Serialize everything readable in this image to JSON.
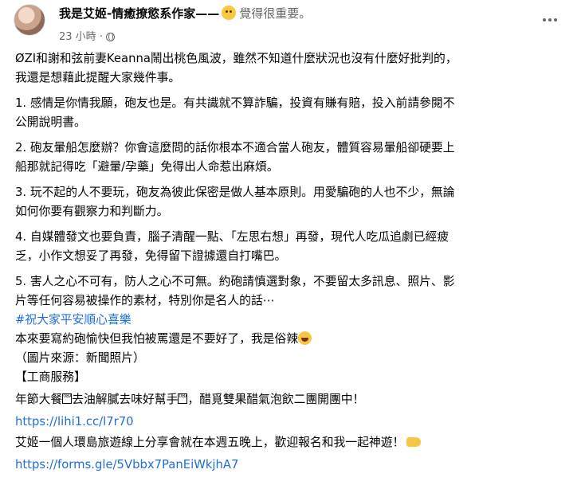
{
  "header": {
    "author": "我是艾姬-情癒撩慾系作家",
    "dash": "——",
    "feeling_icon": "thinking-face-emoji",
    "feeling": "覺得很重要。",
    "timestamp": "23 小時",
    "separator": "·",
    "privacy_icon": "globe-icon",
    "more_icon": "more-options-icon"
  },
  "post": {
    "intro": [
      "ØZI和謝和弦前妻Keanna鬧出桃色風波，雖然不知道什麼狀況也沒有什麼好批判的，",
      "我還是想藉此提醒大家幾件事。"
    ],
    "point1": [
      "1. 感情是你情我願，砲友也是。有共識就不算詐騙，投資有賺有賠，投入前請參閱不",
      "公開說明書。"
    ],
    "point2": [
      "2. 砲友暈船怎麼辦？你會這麼問的話你根本不適合當人砲友，體質容易暈船卻硬要上",
      "船那就記得吃「避暈/孕藥」免得出人命惹出麻煩。"
    ],
    "point3": [
      "3. 玩不起的人不要玩，砲友為彼此保密是做人基本原則。用愛騙砲的人也不少，無論",
      "如何你要有觀察力和判斷力。"
    ],
    "point4": [
      "4. 自媒體發文也要負責，腦子清醒一點、「左思右想」再發，現代人吃瓜追劇已經疲",
      "乏，小作文想妥了再發，免得留下證據還自打嘴巴。"
    ],
    "point5": [
      "5. 害人之心不可有，防人之心不可無。約砲請慎選對象，不要留太多訊息、照片、影",
      "片等任何容易被操作的素材，特別你是名人的話⋯"
    ],
    "hashtag": "#祝大家平安順心喜樂",
    "closing": "本來要寫約砲愉快但我怕被罵還是不要好了，我是俗辣",
    "closing_emoji": "laughing-crying-emoji",
    "source": "（圖片來源：新聞照片）",
    "business_title": "【工商服務】",
    "promo1_a": "年節大餐",
    "promo1_b": "去油解膩去味好幫手",
    "promo1_c": "，醋覓雙果醋氣泡飲二團開團中！",
    "box_glyph": "0BA",
    "link1": "https://lihi1.cc/l7r70",
    "promo2": "艾姬一個人環島旅遊線上分享會就在本週五晚上，歡迎報名和我一起神遊！",
    "promo2_emoji": "pointing-hand-emoji",
    "link2": "https://forms.gle/5Vbbx7PanEiWkjhA7"
  }
}
